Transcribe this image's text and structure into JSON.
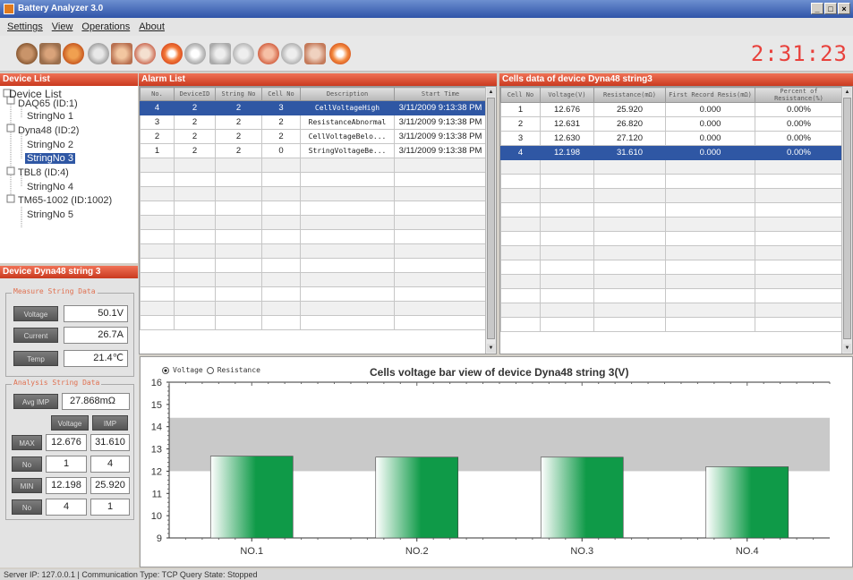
{
  "window": {
    "title": "Battery Analyzer 3.0",
    "controls": [
      "_",
      "□",
      "×"
    ]
  },
  "menu": [
    "Settings",
    "View",
    "Operations",
    "About"
  ],
  "toolbar": {
    "clock": "2:31:23"
  },
  "device_list": {
    "header": "Device List",
    "items": [
      {
        "label": "Device List",
        "level": 0,
        "selected": false
      },
      {
        "label": "DAQ65 (ID:1)",
        "level": 1,
        "selected": false
      },
      {
        "label": "StringNo 1",
        "level": 2,
        "selected": false
      },
      {
        "label": "Dyna48 (ID:2)",
        "level": 1,
        "selected": false
      },
      {
        "label": "StringNo 2",
        "level": 2,
        "selected": false
      },
      {
        "label": "StringNo 3",
        "level": 2,
        "selected": true
      },
      {
        "label": "TBL8 (ID:4)",
        "level": 1,
        "selected": false
      },
      {
        "label": "StringNo 4",
        "level": 2,
        "selected": false
      },
      {
        "label": "TM65-1002 (ID:1002)",
        "level": 1,
        "selected": false
      },
      {
        "label": "StringNo 5",
        "level": 2,
        "selected": false
      }
    ]
  },
  "device_panel": {
    "header": "Device Dyna48 string 3",
    "measure": {
      "legend": "Measure String Data",
      "rows": [
        {
          "label": "Voltage",
          "value": "50.1V"
        },
        {
          "label": "Current",
          "value": "26.7A"
        },
        {
          "label": "Temp",
          "value": "21.4℃"
        }
      ]
    },
    "analysis": {
      "legend": "Analysis String Data",
      "avg_label": "Avg IMP",
      "avg_value": "27.868mΩ",
      "col_voltage": "Voltage",
      "col_imp": "IMP",
      "rows": [
        {
          "label": "MAX",
          "v": "12.676",
          "r": "31.610"
        },
        {
          "label": "No",
          "v": "1",
          "r": "4"
        },
        {
          "label": "MIN",
          "v": "12.198",
          "r": "25.920"
        },
        {
          "label": "No",
          "v": "4",
          "r": "1"
        }
      ]
    }
  },
  "alarm": {
    "header": "Alarm List",
    "columns": [
      "No.",
      "DeviceID",
      "String No",
      "Cell No",
      "Description",
      "Start Time"
    ],
    "rows": [
      [
        "4",
        "2",
        "2",
        "3",
        "CellVoltageHigh",
        "3/11/2009 9:13:38 PM"
      ],
      [
        "3",
        "2",
        "2",
        "2",
        "ResistanceAbnormal",
        "3/11/2009 9:13:38 PM"
      ],
      [
        "2",
        "2",
        "2",
        "2",
        "CellVoltageBelo...",
        "3/11/2009 9:13:38 PM"
      ],
      [
        "1",
        "2",
        "2",
        "0",
        "StringVoltageBe...",
        "3/11/2009 9:13:38 PM"
      ]
    ]
  },
  "cells": {
    "header": "Cells data of device Dyna48 string3",
    "columns": [
      "Cell No",
      "Voltage(V)",
      "Resistance(mΩ)",
      "First Record Resis(mΩ)",
      "Percent of Resistance(%)"
    ],
    "rows": [
      [
        "1",
        "12.676",
        "25.920",
        "0.000",
        "0.00%"
      ],
      [
        "2",
        "12.631",
        "26.820",
        "0.000",
        "0.00%"
      ],
      [
        "3",
        "12.630",
        "27.120",
        "0.000",
        "0.00%"
      ],
      [
        "4",
        "12.198",
        "31.610",
        "0.000",
        "0.00%"
      ]
    ]
  },
  "chart_options": {
    "voltage": "Voltage",
    "resistance": "Resistance"
  },
  "chart_data": {
    "type": "bar",
    "title": "Cells voltage bar view of device Dyna48 string 3(V)",
    "categories": [
      "NO.1",
      "NO.2",
      "NO.3",
      "NO.4"
    ],
    "values": [
      12.676,
      12.631,
      12.63,
      12.198
    ],
    "ylim": [
      9,
      16
    ],
    "yticks": [
      "9",
      "10",
      "11",
      "12",
      "13",
      "14",
      "15",
      "16"
    ],
    "band": [
      12,
      14.4
    ],
    "colors": {
      "bar_light": "#ffffff",
      "bar_dark": "#0f9a48",
      "band": "#c9c9c9"
    }
  },
  "status": {
    "text": "Server IP: 127.0.0.1 | Communication Type: TCP    Query State: Stopped"
  }
}
